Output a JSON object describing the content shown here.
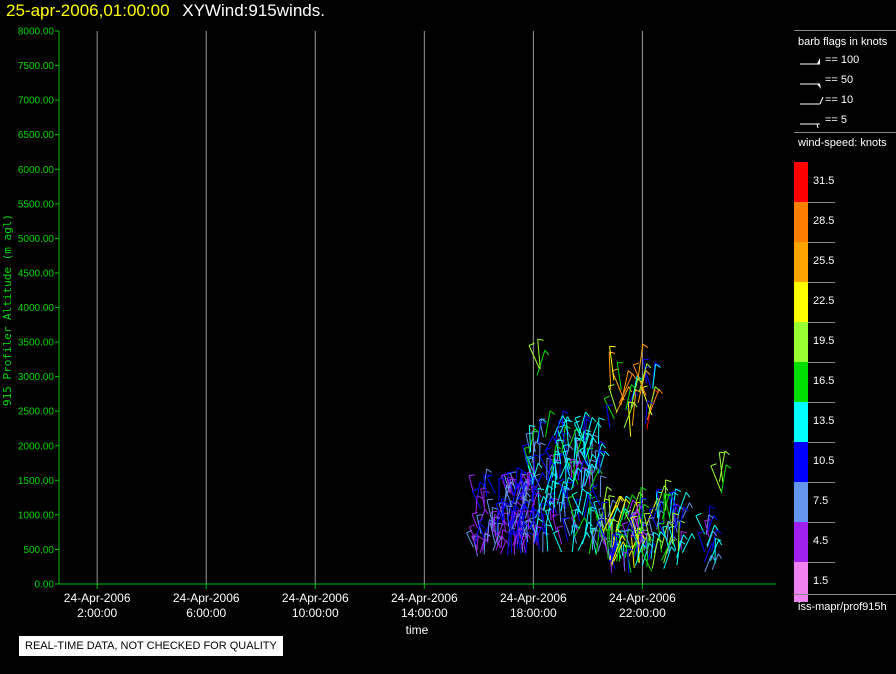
{
  "header": {
    "date": "25-apr-2006,01:00:00",
    "product": "XYWind:915winds."
  },
  "notice": "REAL-TIME DATA, NOT CHECKED FOR QUALITY",
  "chart_data": {
    "type": "scatter",
    "title": "",
    "xlabel": "time",
    "ylabel": "915 Profiler Altitude (m agl)",
    "ylim": [
      0,
      8000
    ],
    "xlim_hours": [
      0.6,
      26.9
    ],
    "yticks": [
      "0.00",
      "500.00",
      "1000.00",
      "1500.00",
      "2000.00",
      "2500.00",
      "3000.00",
      "3500.00",
      "4000.00",
      "4500.00",
      "5000.00",
      "5500.00",
      "6000.00",
      "6500.00",
      "7000.00",
      "7500.00",
      "8000.00"
    ],
    "xticks": [
      {
        "hour": 2,
        "date": "24-Apr-2006",
        "time": "2:00:00"
      },
      {
        "hour": 6,
        "date": "24-Apr-2006",
        "time": "6:00:00"
      },
      {
        "hour": 10,
        "date": "24-Apr-2006",
        "time": "10:00:00"
      },
      {
        "hour": 14,
        "date": "24-Apr-2006",
        "time": "14:00:00"
      },
      {
        "hour": 18,
        "date": "24-Apr-2006",
        "time": "18:00:00"
      },
      {
        "hour": 22,
        "date": "24-Apr-2006",
        "time": "22:00:00"
      }
    ],
    "grid": "vertical",
    "barb_legend": {
      "title": "barb flags in knots",
      "entries": [
        "== 100",
        "== 50",
        "== 10",
        "== 5"
      ]
    },
    "color_legend": {
      "title": "wind-speed: knots",
      "entries": [
        {
          "label": "31.5",
          "color": "#ff0000"
        },
        {
          "label": "28.5",
          "color": "#ff8000"
        },
        {
          "label": "25.5",
          "color": "#ffa500"
        },
        {
          "label": "22.5",
          "color": "#ffff00"
        },
        {
          "label": "19.5",
          "color": "#9aff30"
        },
        {
          "label": "16.5",
          "color": "#00e000"
        },
        {
          "label": "13.5",
          "color": "#00ffff"
        },
        {
          "label": "10.5",
          "color": "#0000ff"
        },
        {
          "label": "7.5",
          "color": "#6495ed"
        },
        {
          "label": "4.5",
          "color": "#a020f0"
        },
        {
          "label": "1.5",
          "color": "#ee82ee"
        }
      ]
    },
    "source": "iss-mapr/prof915h",
    "clusters": [
      {
        "t": [
          15.8,
          17.8
        ],
        "alt": [
          400,
          1400
        ],
        "speed": [
          3,
          12
        ],
        "count": 120
      },
      {
        "t": [
          17.8,
          20.5
        ],
        "alt": [
          400,
          2200
        ],
        "speed": [
          5,
          16
        ],
        "count": 170
      },
      {
        "t": [
          20.5,
          22.2
        ],
        "alt": [
          150,
          1000
        ],
        "speed": [
          4,
          24
        ],
        "count": 90
      },
      {
        "t": [
          22.2,
          23.5
        ],
        "alt": [
          150,
          1100
        ],
        "speed": [
          5,
          20
        ],
        "count": 45
      },
      {
        "t": [
          20.8,
          22.4
        ],
        "alt": [
          2100,
          3000
        ],
        "speed": [
          10,
          32
        ],
        "count": 30
      },
      {
        "t": [
          18.0,
          18.3
        ],
        "alt": [
          2800,
          3200
        ],
        "speed": [
          16,
          21
        ],
        "count": 3
      },
      {
        "t": [
          19.7,
          20.1
        ],
        "alt": [
          1700,
          2300
        ],
        "speed": [
          9,
          14
        ],
        "count": 8
      },
      {
        "t": [
          24.2,
          24.7
        ],
        "alt": [
          150,
          900
        ],
        "speed": [
          5,
          14
        ],
        "count": 14
      },
      {
        "t": [
          24.8,
          25.0
        ],
        "alt": [
          1300,
          1500
        ],
        "speed": [
          17,
          22
        ],
        "count": 4
      }
    ]
  }
}
